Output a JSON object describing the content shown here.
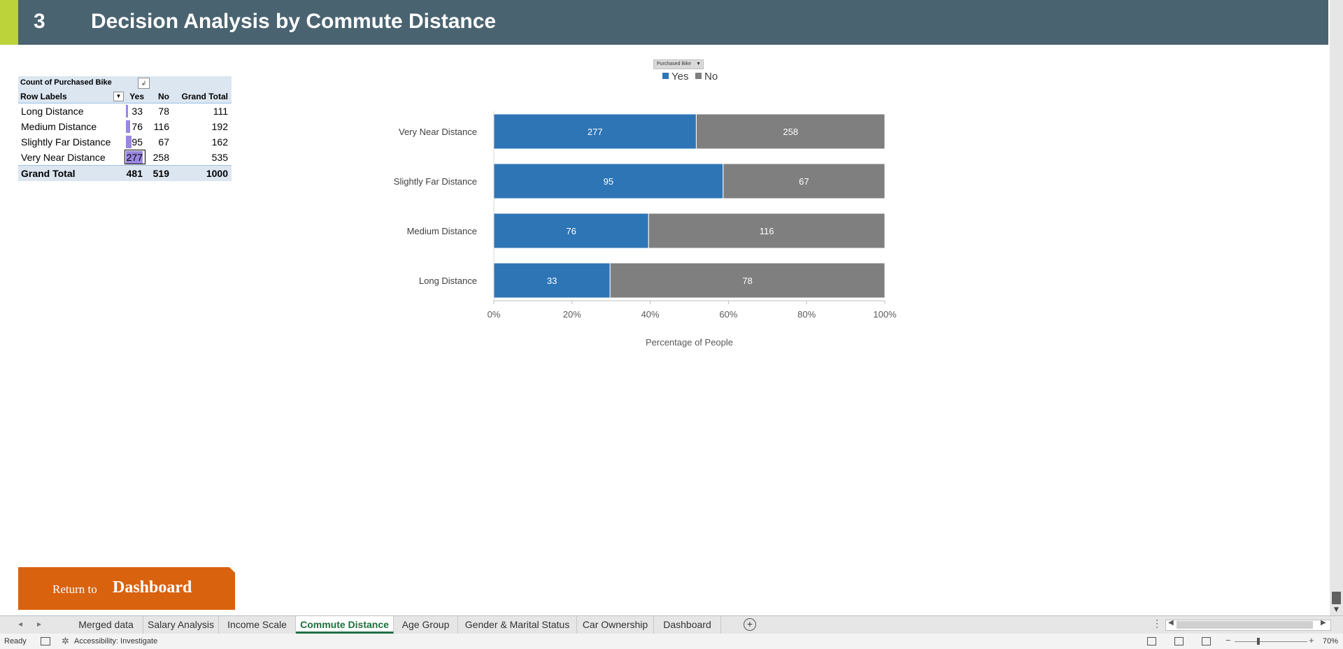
{
  "header": {
    "number": "3",
    "title": "Decision Analysis by Commute Distance"
  },
  "pivot": {
    "title": "Count of Purchased Bike",
    "col_labels": {
      "row_labels": "Row Labels",
      "yes": "Yes",
      "no": "No",
      "grand_total": "Grand Total"
    },
    "rows": [
      {
        "label": "Long Distance",
        "yes": "33",
        "no": "78",
        "total": "111"
      },
      {
        "label": "Medium Distance",
        "yes": "76",
        "no": "116",
        "total": "192"
      },
      {
        "label": "Slightly Far Distance",
        "yes": "95",
        "no": "67",
        "total": "162"
      },
      {
        "label": "Very Near Distance",
        "yes": "277",
        "no": "258",
        "total": "535"
      }
    ],
    "yes_bar_fraction": [
      0.12,
      0.27,
      0.34,
      1.0
    ],
    "grand_total": {
      "label": "Grand Total",
      "yes": "481",
      "no": "519",
      "total": "1000"
    },
    "databar_color": "#9a87e0"
  },
  "chart_filter_label": "Purchased Bike",
  "chart_data": {
    "type": "bar",
    "orientation": "horizontal",
    "stacked": "percent",
    "categories": [
      "Very Near Distance",
      "Slightly Far Distance",
      "Medium Distance",
      "Long Distance"
    ],
    "series": [
      {
        "name": "Yes",
        "values": [
          277,
          95,
          76,
          33
        ],
        "color": "#2e75b6"
      },
      {
        "name": "No",
        "values": [
          258,
          67,
          116,
          78
        ],
        "color": "#7f7f7f"
      }
    ],
    "xlabel": "Percentage of People",
    "x_ticks": [
      "0%",
      "20%",
      "40%",
      "60%",
      "80%",
      "100%"
    ],
    "xlim": [
      0,
      100
    ],
    "legend_position": "top",
    "grid": false
  },
  "return_button": {
    "prefix": "Return to",
    "target": "Dashboard",
    "color": "#d9620f"
  },
  "sheet_tabs": [
    {
      "label": "Merged data",
      "active": false
    },
    {
      "label": "Salary Analysis",
      "active": false
    },
    {
      "label": "Income Scale",
      "active": false
    },
    {
      "label": "Commute Distance",
      "active": true
    },
    {
      "label": "Age Group",
      "active": false
    },
    {
      "label": "Gender & Marital Status",
      "active": false
    },
    {
      "label": "Car Ownership",
      "active": false
    },
    {
      "label": "Dashboard",
      "active": false
    }
  ],
  "status": {
    "ready": "Ready",
    "accessibility": "Accessibility: Investigate",
    "zoom": "70%"
  },
  "colors": {
    "header_bg": "#4a6370",
    "accent": "#bcd43a"
  }
}
